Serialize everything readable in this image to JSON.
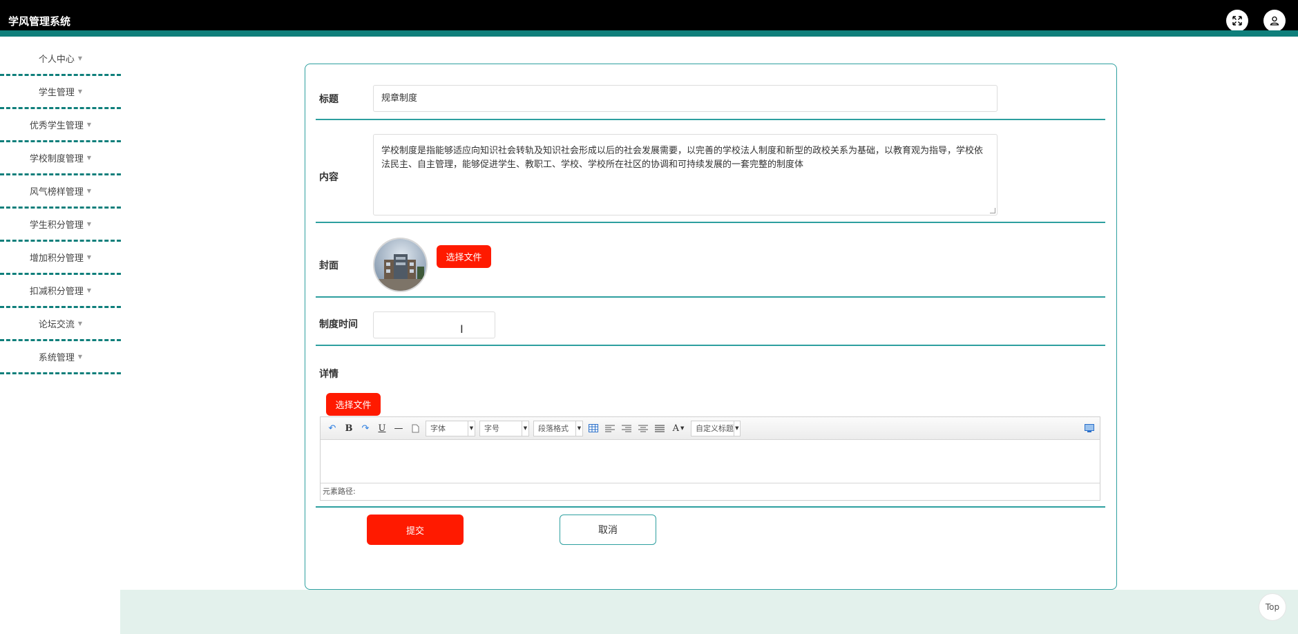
{
  "header": {
    "title": "学风管理系统"
  },
  "sidebar": {
    "items": [
      {
        "label": "个人中心"
      },
      {
        "label": "学生管理"
      },
      {
        "label": "优秀学生管理"
      },
      {
        "label": "学校制度管理"
      },
      {
        "label": "风气榜样管理"
      },
      {
        "label": "学生积分管理"
      },
      {
        "label": "增加积分管理"
      },
      {
        "label": "扣减积分管理"
      },
      {
        "label": "论坛交流"
      },
      {
        "label": "系统管理"
      }
    ]
  },
  "form": {
    "title_label": "标题",
    "title_value": "规章制度",
    "content_label": "内容",
    "content_value": "学校制度是指能够适应向知识社会转轨及知识社会形成以后的社会发展需要，以完善的学校法人制度和新型的政校关系为基础，以教育观为指导，学校依法民主、自主管理，能够促进学生、教职工、学校、学校所在社区的协调和可持续发展的一套完整的制度体",
    "cover_label": "封面",
    "choose_file": "选择文件",
    "date_label": "制度时间",
    "date_value": "",
    "detail_label": "详情",
    "detail_choose_file": "选择文件",
    "submit": "提交",
    "cancel": "取消"
  },
  "editor": {
    "font_select": "字体",
    "size_select": "字号",
    "paragraph_select": "段落格式",
    "custom_title_select": "自定义标题",
    "status_path": "元素路径:"
  },
  "top_button": "Top",
  "colors": {
    "accent_teal": "#0f7f7b",
    "border_teal": "#2d9f9f",
    "button_red": "#ff1a00",
    "footer_band": "#e3f1ec"
  }
}
